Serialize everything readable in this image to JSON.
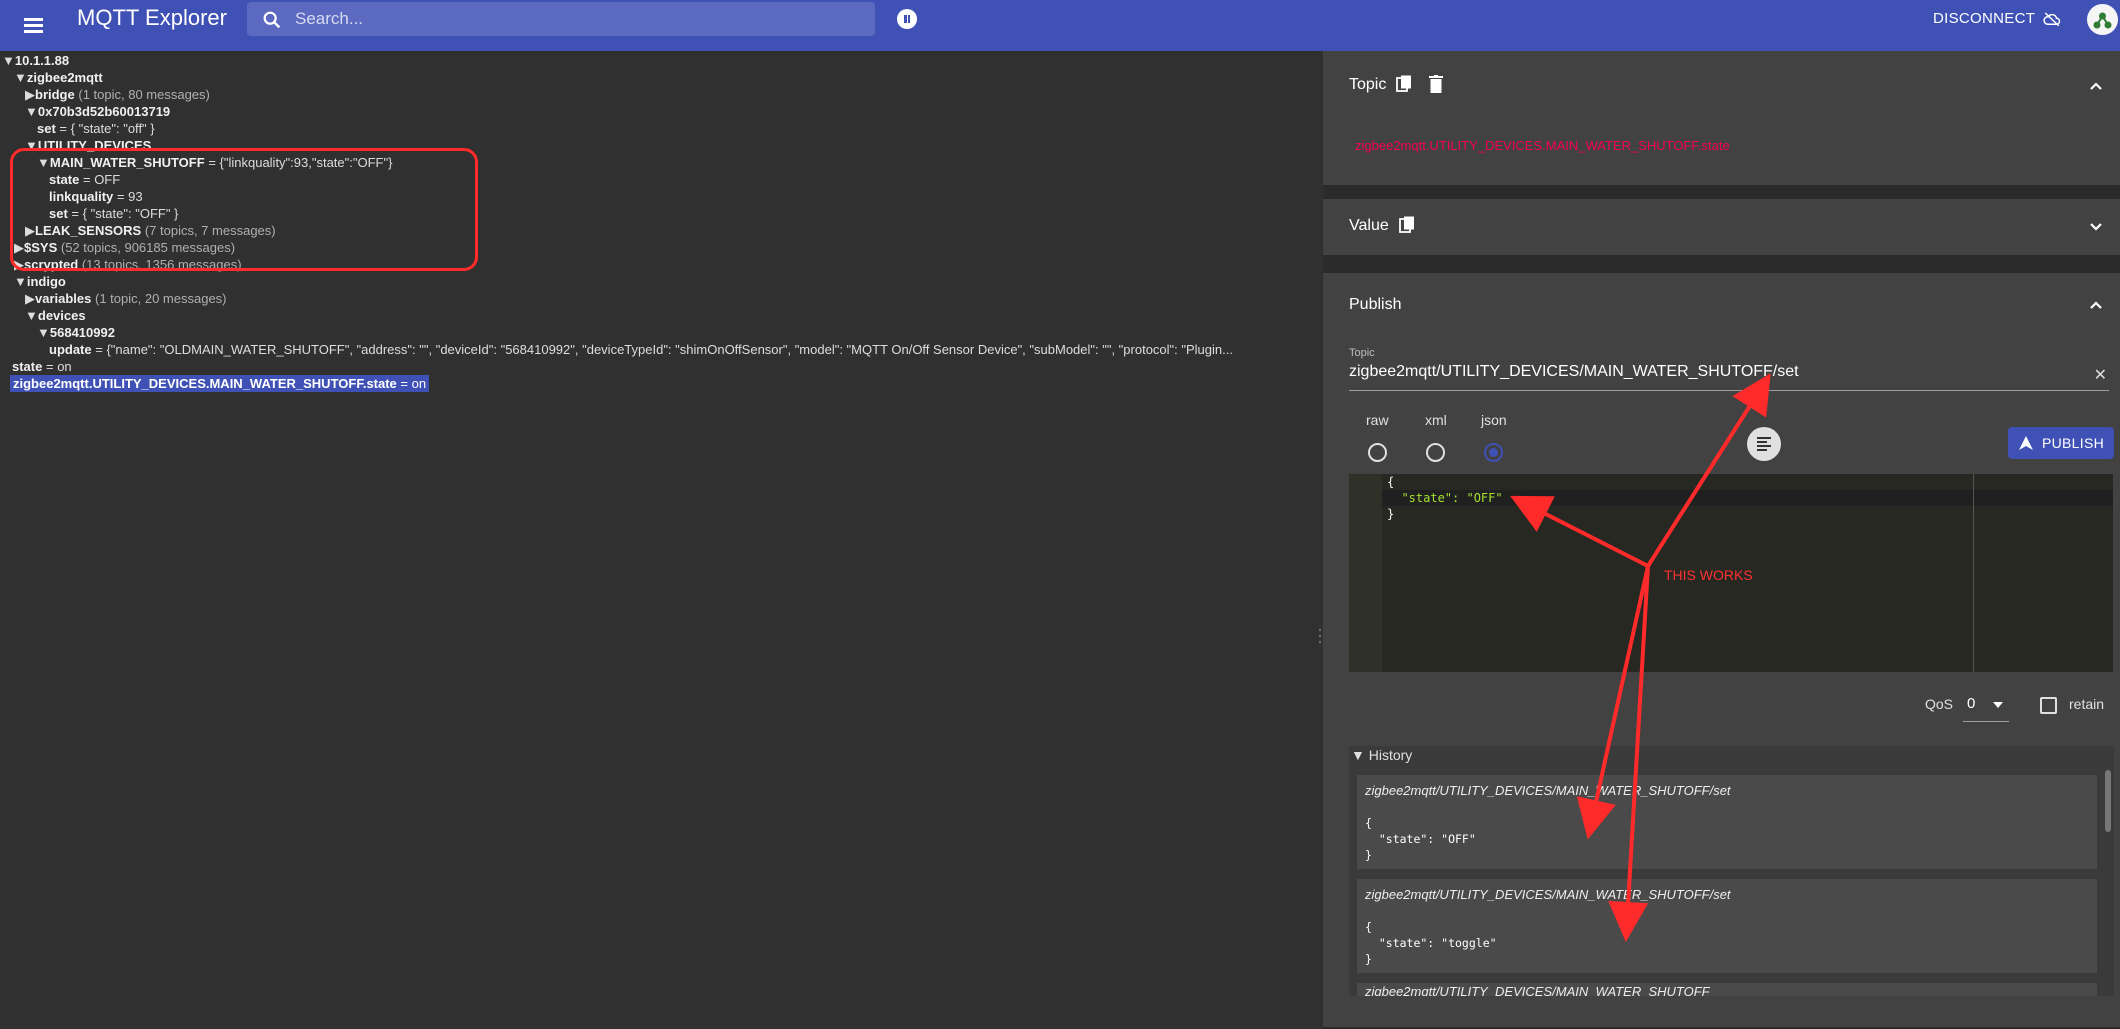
{
  "app": {
    "title": "MQTT Explorer",
    "search_placeholder": "Search...",
    "disconnect_label": "DISCONNECT"
  },
  "tree": {
    "broker": "10.1.1.88",
    "zigbee2mqtt": "zigbee2mqtt",
    "bridge": "bridge",
    "bridge_meta": "(1 topic, 80 messages)",
    "device_id": "0x70b3d52b60013719",
    "device_set_key": "set",
    "device_set_value": "= { \"state\": \"off\" }",
    "utility_devices": "UTILITY_DEVICES",
    "main_water": "MAIN_WATER_SHUTOFF",
    "main_water_value": "= {\"linkquality\":93,\"state\":\"OFF\"}",
    "state_key": "state",
    "state_value": "= OFF",
    "linkquality_key": "linkquality",
    "linkquality_value": "= 93",
    "set_key": "set",
    "set_value": "= { \"state\": \"OFF\" }",
    "leak_sensors": "LEAK_SENSORS",
    "leak_meta": "(7 topics, 7 messages)",
    "sys": "$SYS",
    "sys_meta": "(52 topics, 906185 messages)",
    "scrypted": "scrypted",
    "scrypted_meta": "(13 topics, 1356 messages)",
    "indigo": "indigo",
    "variables": "variables",
    "variables_meta": "(1 topic, 20 messages)",
    "devices": "devices",
    "device_568": "568410992",
    "update_key": "update",
    "update_value": "= {\"name\": \"OLDMAIN_WATER_SHUTOFF\", \"address\": \"\", \"deviceId\": \"568410992\", \"deviceTypeId\": \"shimOnOffSensor\", \"model\": \"MQTT On/Off Sensor Device\", \"subModel\": \"\", \"protocol\": \"Plugin...",
    "root_state_key": "state",
    "root_state_value": "= on",
    "selected_key": "zigbee2mqtt.UTILITY_DEVICES.MAIN_WATER_SHUTOFF.state",
    "selected_value": "= on"
  },
  "panel": {
    "topic_title": "Topic",
    "topic_path": "zigbee2mqtt.UTILITY_DEVICES.MAIN_WATER_SHUTOFF.state",
    "value_title": "Value",
    "publish_title": "Publish",
    "publish_topic_label": "Topic",
    "publish_topic_value": "zigbee2mqtt/UTILITY_DEVICES/MAIN_WATER_SHUTOFF/set",
    "formats": [
      "raw",
      "xml",
      "json"
    ],
    "selected_format": "json",
    "publish_button": "PUBLISH",
    "editor_lines": [
      "{",
      "  \"state\": \"OFF\"",
      "}"
    ],
    "qos_label": "QoS",
    "qos_value": "0",
    "retain_label": "retain",
    "history_title": "History",
    "history": [
      {
        "topic": "zigbee2mqtt/UTILITY_DEVICES/MAIN_WATER_SHUTOFF/set",
        "body": "{\n  \"state\": \"OFF\"\n}"
      },
      {
        "topic": "zigbee2mqtt/UTILITY_DEVICES/MAIN_WATER_SHUTOFF/set",
        "body": "{\n  \"state\": \"toggle\"\n}"
      },
      {
        "topic": "zigbee2mqtt/UTILITY_DEVICES/MAIN_WATER_SHUTOFF",
        "body": ""
      }
    ]
  },
  "annotation": {
    "text": "THIS WORKS",
    "color": "#ff3030"
  },
  "colors": {
    "appbar": "#3f51b5",
    "accent_pink": "#f50057",
    "highlight_red": "#ff2a2a"
  }
}
